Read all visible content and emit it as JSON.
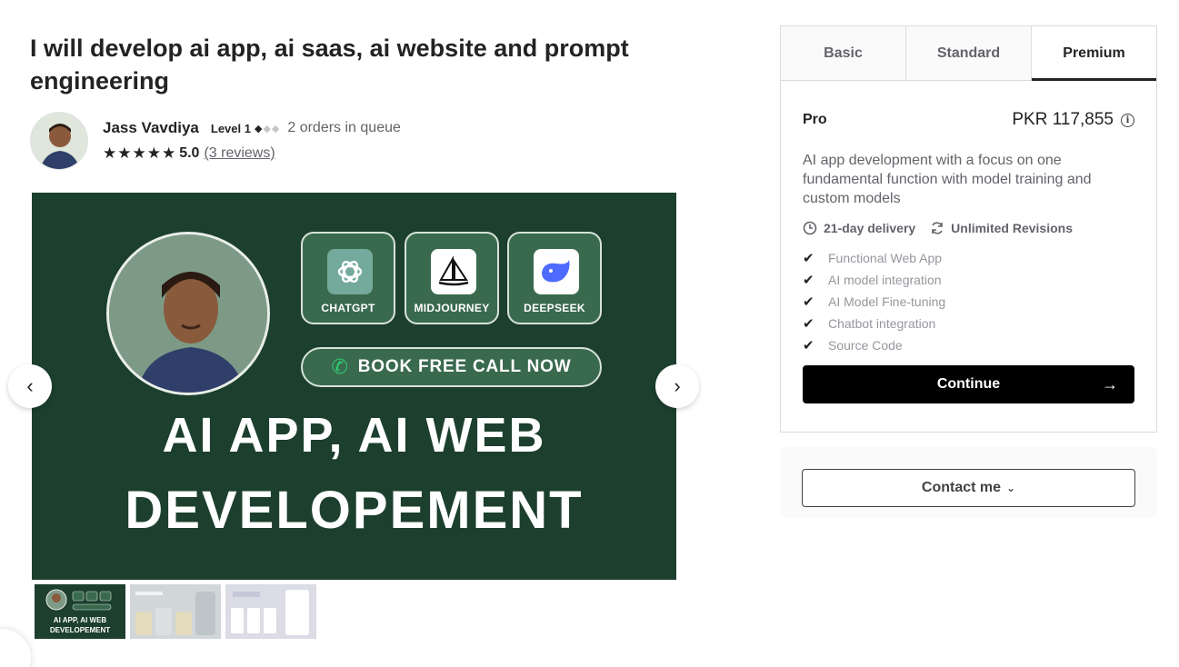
{
  "gig": {
    "title": "I will develop ai app, ai saas, ai website and prompt engineering"
  },
  "seller": {
    "name": "Jass Vavdiya",
    "level": "Level 1",
    "level_filled": 1,
    "level_total": 3,
    "queue": "2 orders in queue",
    "stars": "★★★★★",
    "rating": "5.0",
    "reviews": "(3 reviews)"
  },
  "gallery": {
    "tools": [
      {
        "label": "CHATGPT",
        "icon": "chatgpt-icon"
      },
      {
        "label": "MIDJOURNEY",
        "icon": "midjourney-icon"
      },
      {
        "label": "DEEPSEEK",
        "icon": "deepseek-icon"
      }
    ],
    "cta": "BOOK FREE CALL NOW",
    "headline_1": "AI APP, AI WEB",
    "headline_2": "DEVELOPEMENT",
    "prev_icon": "‹",
    "next_icon": "›",
    "thumb_1_line1": "AI APP, AI WEB",
    "thumb_1_line2": "DEVELOPEMENT"
  },
  "packages": {
    "tabs": [
      "Basic",
      "Standard",
      "Premium"
    ],
    "active_tab": "Premium",
    "name": "Pro",
    "price": "PKR 117,855",
    "description": "AI app development with a focus on one fundamental function with model training and custom models",
    "delivery": "21-day delivery",
    "revisions": "Unlimited Revisions",
    "features": [
      "Functional Web App",
      "AI model integration",
      "AI Model Fine-tuning",
      "Chatbot integration",
      "Source Code"
    ],
    "continue_label": "Continue",
    "continue_arrow": "→",
    "contact_label": "Contact me"
  },
  "colors": {
    "slide_bg": "#1c3f2e",
    "card_bg": "#3a6a4e",
    "accent_dark": "#222325",
    "muted": "#62646a"
  }
}
